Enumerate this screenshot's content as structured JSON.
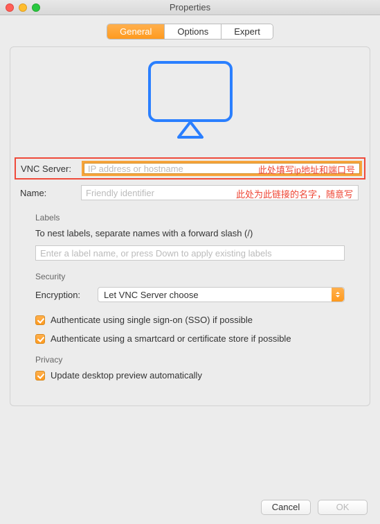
{
  "window": {
    "title": "Properties"
  },
  "tabs": {
    "general": "General",
    "options": "Options",
    "expert": "Expert"
  },
  "vnc": {
    "label": "VNC Server:",
    "placeholder": "IP address or hostname",
    "hint": "此处填写ip地址和端口号"
  },
  "name": {
    "label": "Name:",
    "placeholder": "Friendly identifier",
    "hint": "此处为此链接的名字，随意写"
  },
  "labels_section": {
    "title": "Labels",
    "helper": "To nest labels, separate names with a forward slash (/)",
    "placeholder": "Enter a label name, or press Down to apply existing labels"
  },
  "security": {
    "title": "Security",
    "encryption_label": "Encryption:",
    "encryption_value": "Let VNC Server choose",
    "sso": "Authenticate using single sign-on (SSO) if possible",
    "smartcard": "Authenticate using a smartcard or certificate store if possible"
  },
  "privacy": {
    "title": "Privacy",
    "preview": "Update desktop preview automatically"
  },
  "buttons": {
    "cancel": "Cancel",
    "ok": "OK"
  }
}
